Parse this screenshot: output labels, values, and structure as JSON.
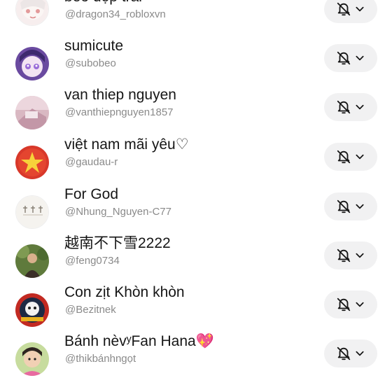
{
  "following": [
    {
      "name": "béo đẹp trai",
      "handle": "@dragon34_robloxvn",
      "avatar": "anime-white-hair-avatar",
      "bell_icon": "bell-off-icon",
      "chevron_icon": "chevron-down-icon"
    },
    {
      "name": "sumicute",
      "handle": "@subobeo",
      "avatar": "anime-purple-avatar",
      "bell_icon": "bell-off-icon",
      "chevron_icon": "chevron-down-icon"
    },
    {
      "name": "van thiep nguyen",
      "handle": "@vanthiepnguyen1857",
      "avatar": "pink-room-avatar",
      "bell_icon": "bell-off-icon",
      "chevron_icon": "chevron-down-icon"
    },
    {
      "name": "việt nam mãi yêu♡",
      "handle": "@gaudau-r",
      "avatar": "vietnam-flag-avatar",
      "bell_icon": "bell-off-icon",
      "chevron_icon": "chevron-down-icon"
    },
    {
      "name": "For God",
      "handle": "@Nhung_Nguyen-C77",
      "avatar": "crosses-avatar",
      "bell_icon": "bell-off-icon",
      "chevron_icon": "chevron-down-icon"
    },
    {
      "name": "越南不下雪2222",
      "handle": "@feng0734",
      "avatar": "outdoor-person-avatar",
      "bell_icon": "bell-off-icon",
      "chevron_icon": "chevron-down-icon"
    },
    {
      "name": "Con zịt Khòn khòn",
      "handle": "@Bezitnek",
      "avatar": "badge-emblem-avatar",
      "bell_icon": "bell-off-icon",
      "chevron_icon": "chevron-down-icon"
    },
    {
      "name": "Bánh nèvʸFan Hana💖",
      "handle": "@thikbánhngọt",
      "avatar": "child-photo-avatar",
      "bell_icon": "bell-off-icon",
      "chevron_icon": "chevron-down-icon"
    }
  ],
  "colors": {
    "name_text": "#161616",
    "handle_text": "#8a8a8a",
    "button_bg": "#f1f1f2",
    "icon_stroke": "#161616"
  }
}
